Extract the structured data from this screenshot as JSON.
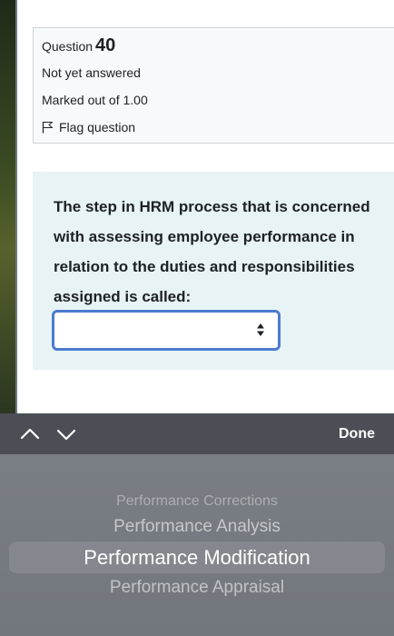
{
  "question": {
    "label": "Question",
    "number": "40",
    "state": "Not yet answered",
    "grade": "Marked out of 1.00",
    "flag_label": "Flag question",
    "text": "The step in HRM process that is concerned with assessing employee performance in relation to the duties and responsibilities assigned is called:",
    "select_value": ""
  },
  "toolbar": {
    "done_label": "Done"
  },
  "picker": {
    "options": [
      "Performance Corrections",
      "Performance Analysis",
      "Performance Modification",
      "Performance Appraisal"
    ],
    "selected": "Performance Modification"
  },
  "colors": {
    "accent": "#4a7bd0",
    "question_bg": "#e7f3f5",
    "toolbar_bg": "#4b4f55",
    "picker_bg": "#767b81"
  }
}
